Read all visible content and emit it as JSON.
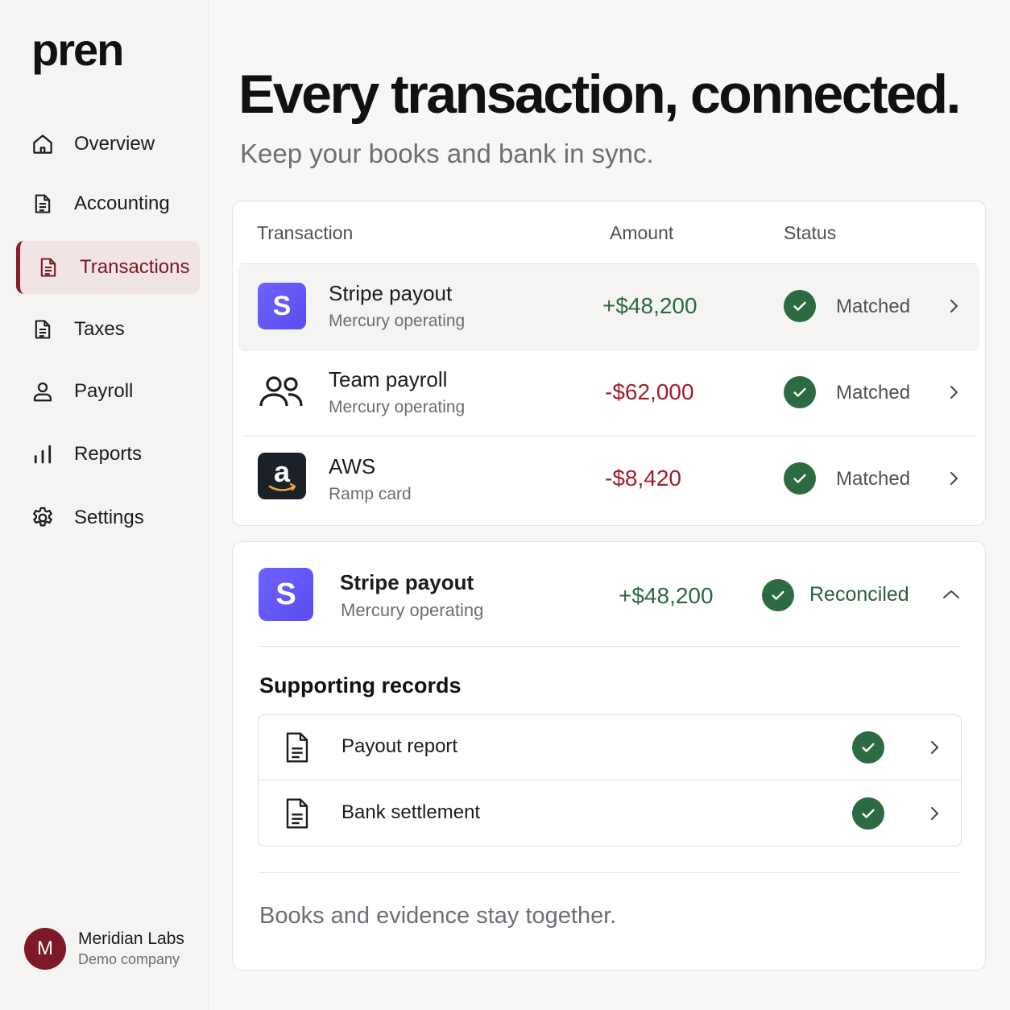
{
  "brand": {
    "name": "pren"
  },
  "nav": [
    {
      "label": "Overview",
      "icon": "home-icon"
    },
    {
      "label": "Accounting",
      "icon": "document-icon"
    },
    {
      "label": "Transactions",
      "icon": "document-icon",
      "active": true
    },
    {
      "label": "Taxes",
      "icon": "document-icon"
    },
    {
      "label": "Payroll",
      "icon": "person-icon"
    },
    {
      "label": "Reports",
      "icon": "bar-chart-icon"
    },
    {
      "label": "Settings",
      "icon": "gear-icon"
    }
  ],
  "user": {
    "initial": "M",
    "name": "Meridian Labs",
    "subtitle": "Demo company"
  },
  "hero": {
    "title": "Every transaction, connected.",
    "subtitle": "Keep your books and bank in sync."
  },
  "table": {
    "headers": {
      "transaction": "Transaction",
      "amount": "Amount",
      "status": "Status"
    },
    "rows": [
      {
        "name": "Stripe payout",
        "account": "Mercury operating",
        "amount": "+$48,200",
        "status": "Matched",
        "icon": "stripe-logo-icon",
        "badge_text": "S"
      },
      {
        "name": "Team payroll",
        "account": "Mercury operating",
        "amount": "-$62,000",
        "status": "Matched",
        "icon": "people-icon"
      },
      {
        "name": "AWS",
        "account": "Ramp card",
        "amount": "-$8,420",
        "status": "Matched",
        "icon": "amazon-logo-icon",
        "badge_text": "a"
      }
    ]
  },
  "detail": {
    "name": "Stripe payout",
    "account": "Mercury operating",
    "amount": "+$48,200",
    "status": "Reconciled",
    "badge_text": "S",
    "section_title": "Supporting records",
    "records": [
      {
        "label": "Payout report",
        "icon": "document-icon"
      },
      {
        "label": "Bank settlement",
        "icon": "document-icon"
      }
    ],
    "footer": "Books and evidence stay together."
  },
  "colors": {
    "accent": "#7a1626",
    "positive": "#2a6a3f",
    "negative": "#a11d2b",
    "check": "#2c6b41",
    "stripe": "#635bff"
  }
}
